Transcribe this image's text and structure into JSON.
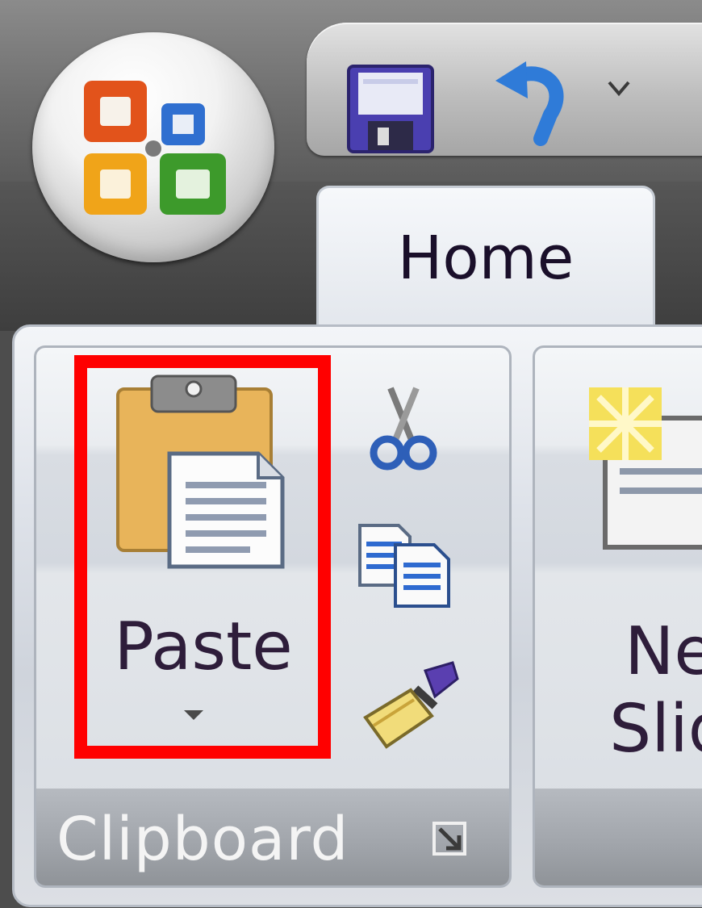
{
  "ribbon": {
    "tabs": [
      {
        "label": "Home",
        "selected": true
      }
    ],
    "groups": {
      "clipboard": {
        "label": "Clipboard",
        "paste_label": "Paste",
        "highlighted": "paste-button",
        "highlight_color": "#ff0000"
      },
      "slides": {
        "new_slide_line1": "Ne",
        "new_slide_line2": "Slid"
      }
    }
  },
  "icons": {
    "office_button": "office-orb-icon",
    "save": "save-icon",
    "undo": "undo-icon",
    "qat_more": "chevron-down-icon",
    "cut": "scissors-icon",
    "copy": "copy-icon",
    "format_painter": "paintbrush-icon",
    "dialog_launcher": "dialog-launcher-icon",
    "new_slide": "new-slide-icon"
  }
}
